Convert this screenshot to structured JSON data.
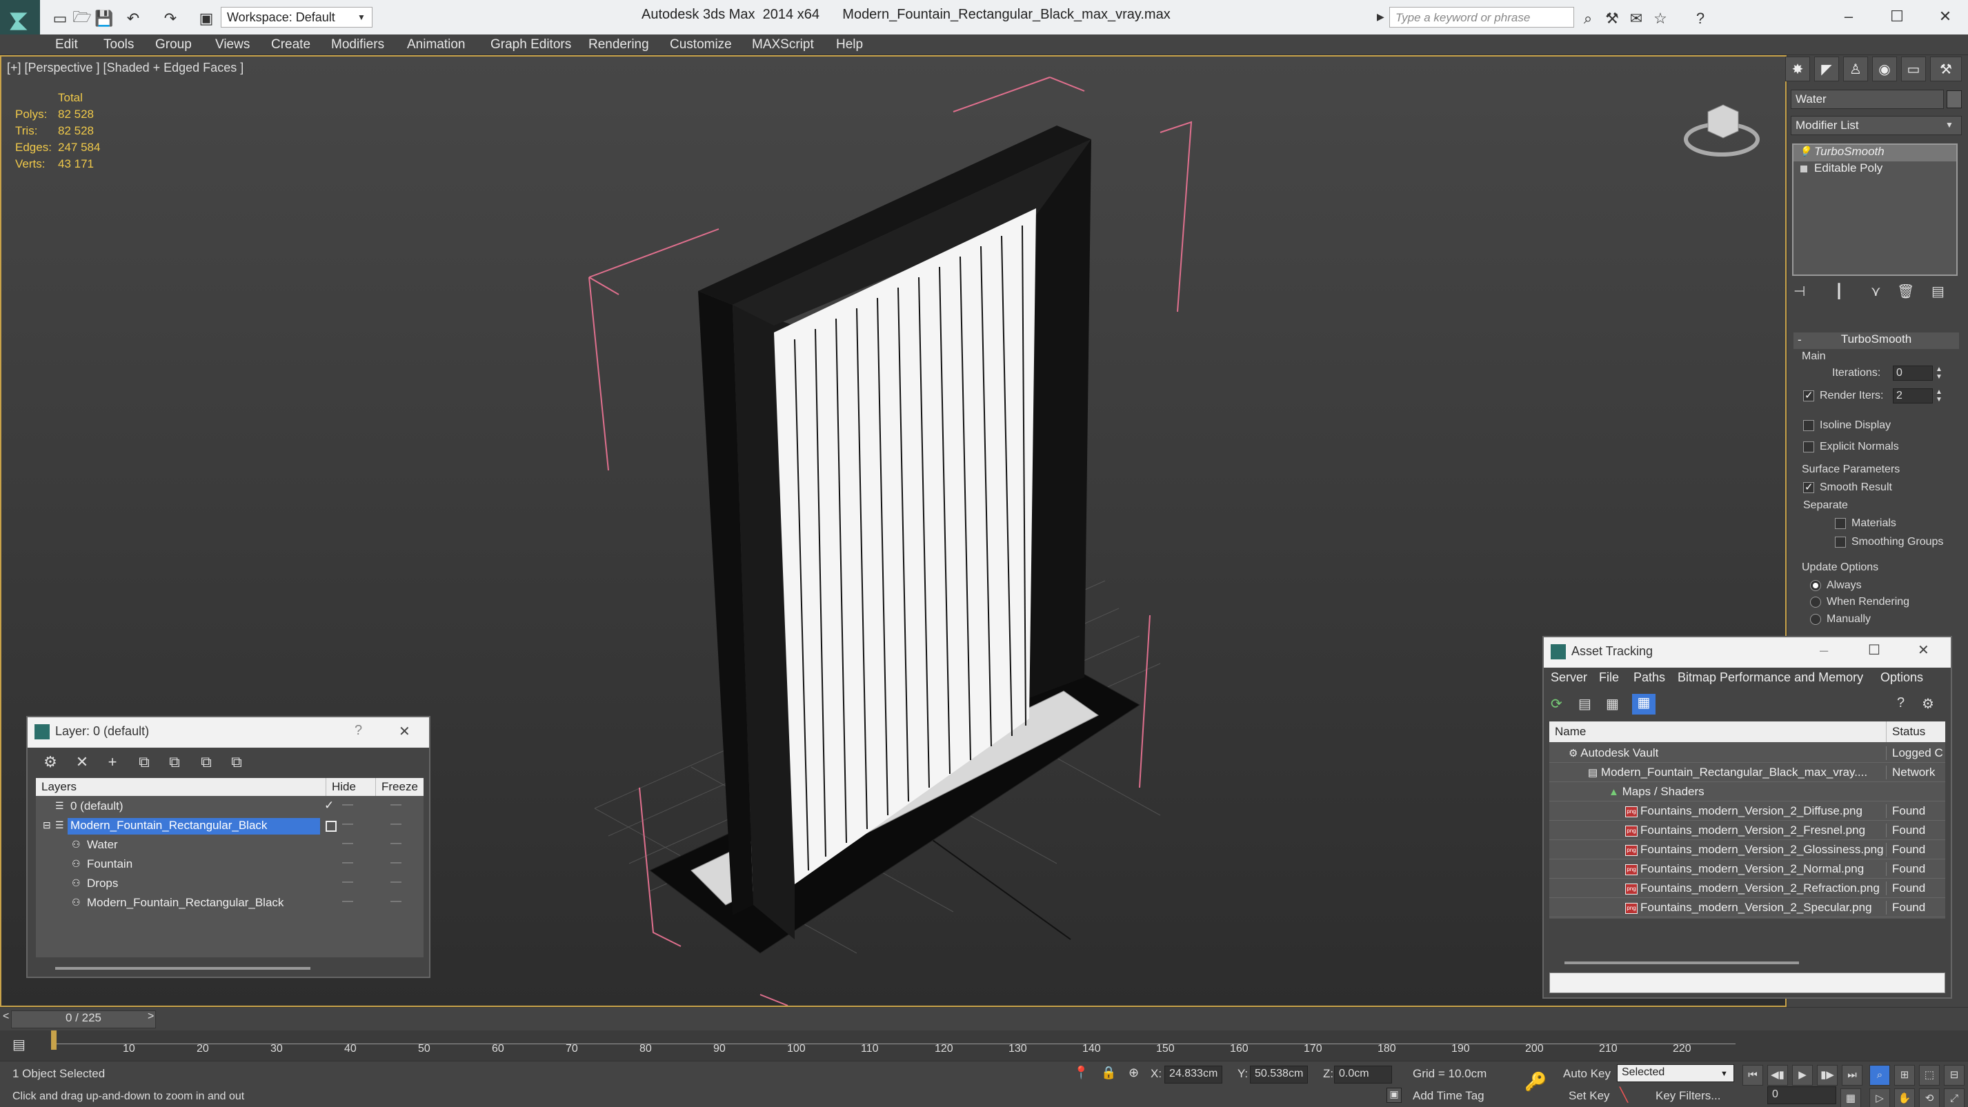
{
  "app": {
    "title": "Autodesk 3ds Max  2014 x64      Modern_Fountain_Rectangular_Black_max_vray.max",
    "workspace": "Workspace: Default",
    "search_placeholder": "Type a keyword or phrase"
  },
  "menu": [
    "Edit",
    "Tools",
    "Group",
    "Views",
    "Create",
    "Modifiers",
    "Animation",
    "Graph Editors",
    "Rendering",
    "Customize",
    "MAXScript",
    "Help"
  ],
  "viewport": {
    "label": "[+] [Perspective ] [Shaded + Edged Faces ]",
    "stats": {
      "header": "Total",
      "rows": [
        {
          "label": "Polys:",
          "value": "82 528"
        },
        {
          "label": "Tris:",
          "value": "82 528"
        },
        {
          "label": "Edges:",
          "value": "247 584"
        },
        {
          "label": "Verts:",
          "value": "43 171"
        }
      ]
    }
  },
  "command_panel": {
    "object_name": "Water",
    "modifier_list": "Modifier List",
    "stack": [
      {
        "label": "TurboSmooth",
        "selected": true
      },
      {
        "label": "Editable Poly",
        "selected": false
      }
    ],
    "turbosmooth": {
      "title": "TurboSmooth",
      "main": "Main",
      "iterations_label": "Iterations:",
      "iterations": "0",
      "render_iters_label": "Render Iters:",
      "render_iters": "2",
      "isoline": "Isoline Display",
      "explicit_normals": "Explicit Normals",
      "surface_params": "Surface Parameters",
      "smooth_result": "Smooth Result",
      "separate": "Separate",
      "materials": "Materials",
      "smoothing_groups": "Smoothing Groups",
      "update_options": "Update Options",
      "always": "Always",
      "when_rendering": "When Rendering",
      "manually": "Manually"
    }
  },
  "layer_window": {
    "title": "Layer: 0 (default)",
    "help": "?",
    "close": "✕",
    "columns": {
      "layers": "Layers",
      "hide": "Hide",
      "freeze": "Freeze"
    },
    "rows": [
      {
        "name": "0 (default)",
        "indent": 0,
        "selected": false
      },
      {
        "name": "Modern_Fountain_Rectangular_Black",
        "indent": 0,
        "selected": true
      },
      {
        "name": "Water",
        "indent": 1,
        "selected": false
      },
      {
        "name": "Fountain",
        "indent": 1,
        "selected": false
      },
      {
        "name": "Drops",
        "indent": 1,
        "selected": false
      },
      {
        "name": "Modern_Fountain_Rectangular_Black",
        "indent": 1,
        "selected": false
      }
    ]
  },
  "asset_tracking": {
    "title": "Asset Tracking",
    "menu": [
      "Server",
      "File",
      "Paths",
      "Bitmap Performance and Memory",
      "Options"
    ],
    "columns": {
      "name": "Name",
      "status": "Status"
    },
    "rows": [
      {
        "name": "Autodesk Vault",
        "status": "Logged C",
        "indent": 0
      },
      {
        "name": "Modern_Fountain_Rectangular_Black_max_vray....",
        "status": "Network",
        "indent": 1
      },
      {
        "name": "Maps / Shaders",
        "status": "",
        "indent": 2
      },
      {
        "name": "Fountains_modern_Version_2_Diffuse.png",
        "status": "Found",
        "indent": 3
      },
      {
        "name": "Fountains_modern_Version_2_Fresnel.png",
        "status": "Found",
        "indent": 3
      },
      {
        "name": "Fountains_modern_Version_2_Glossiness.png",
        "status": "Found",
        "indent": 3
      },
      {
        "name": "Fountains_modern_Version_2_Normal.png",
        "status": "Found",
        "indent": 3
      },
      {
        "name": "Fountains_modern_Version_2_Refraction.png",
        "status": "Found",
        "indent": 3
      },
      {
        "name": "Fountains_modern_Version_2_Specular.png",
        "status": "Found",
        "indent": 3
      }
    ]
  },
  "timeline": {
    "frame": "0 / 225",
    "ticks": [
      "10",
      "20",
      "30",
      "40",
      "50",
      "60",
      "70",
      "80",
      "90",
      "100",
      "110",
      "120",
      "130",
      "140",
      "150",
      "160",
      "170",
      "180",
      "190",
      "200",
      "210",
      "220"
    ]
  },
  "status": {
    "selected": "1 Object Selected",
    "prompt": "Click and drag up-and-down to zoom in and out",
    "x_label": "X:",
    "x": "24.833cm",
    "y_label": "Y:",
    "y": "50.538cm",
    "z_label": "Z:",
    "z": "0.0cm",
    "grid": "Grid = 10.0cm",
    "add_time_tag": "Add Time Tag",
    "auto_key": "Auto Key",
    "set_key": "Set Key",
    "selected_mode": "Selected",
    "key_filters": "Key Filters...",
    "current_frame": "0"
  }
}
